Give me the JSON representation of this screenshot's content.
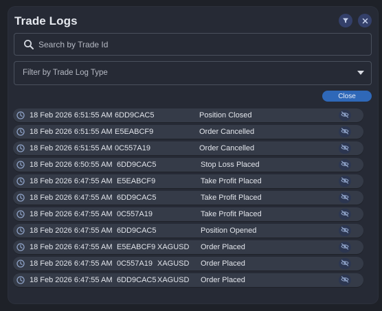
{
  "panel": {
    "title": "Trade Logs",
    "filter_icon": "funnel-icon",
    "close_icon": "x-icon"
  },
  "search": {
    "placeholder": "Search by Trade Id",
    "value": "",
    "icon": "search-icon"
  },
  "filter": {
    "label": "Filter by Trade Log Type",
    "icon": "caret-down-icon"
  },
  "close_button": {
    "label": "Close"
  },
  "logs": [
    {
      "time": "18 Feb 2026 6:51:55 AM",
      "trade_id": "6DD9CAC5",
      "symbol": "",
      "type": "Position Closed"
    },
    {
      "time": "18 Feb 2026 6:51:55 AM",
      "trade_id": "E5EABCF9",
      "symbol": "",
      "type": "Order Cancelled"
    },
    {
      "time": "18 Feb 2026 6:51:55 AM",
      "trade_id": "0C557A19",
      "symbol": "",
      "type": "Order Cancelled"
    },
    {
      "time": "18 Feb 2026 6:50:55 AM",
      "trade_id": "6DD9CAC5",
      "symbol": "",
      "type": "Stop Loss Placed"
    },
    {
      "time": "18 Feb 2026 6:47:55 AM",
      "trade_id": "E5EABCF9",
      "symbol": "",
      "type": "Take Profit Placed"
    },
    {
      "time": "18 Feb 2026 6:47:55 AM",
      "trade_id": "6DD9CAC5",
      "symbol": "",
      "type": "Take Profit Placed"
    },
    {
      "time": "18 Feb 2026 6:47:55 AM",
      "trade_id": "0C557A19",
      "symbol": "",
      "type": "Take Profit Placed"
    },
    {
      "time": "18 Feb 2026 6:47:55 AM",
      "trade_id": "6DD9CAC5",
      "symbol": "",
      "type": "Position Opened"
    },
    {
      "time": "18 Feb 2026 6:47:55 AM",
      "trade_id": "E5EABCF9",
      "symbol": "XAGUSD",
      "type": "Order Placed"
    },
    {
      "time": "18 Feb 2026 6:47:55 AM",
      "trade_id": "0C557A19",
      "symbol": "XAGUSD",
      "type": "Order Placed"
    },
    {
      "time": "18 Feb 2026 6:47:55 AM",
      "trade_id": "6DD9CAC5",
      "symbol": "XAGUSD",
      "type": "Order Placed"
    }
  ],
  "row_icons": {
    "time": "clock-icon",
    "action": "eye-off-icon"
  },
  "colors": {
    "background": "#1e2128",
    "panel": "#262a35",
    "row": "#353b48",
    "accent": "#2f68b8",
    "icon": "#8fa3c8"
  }
}
